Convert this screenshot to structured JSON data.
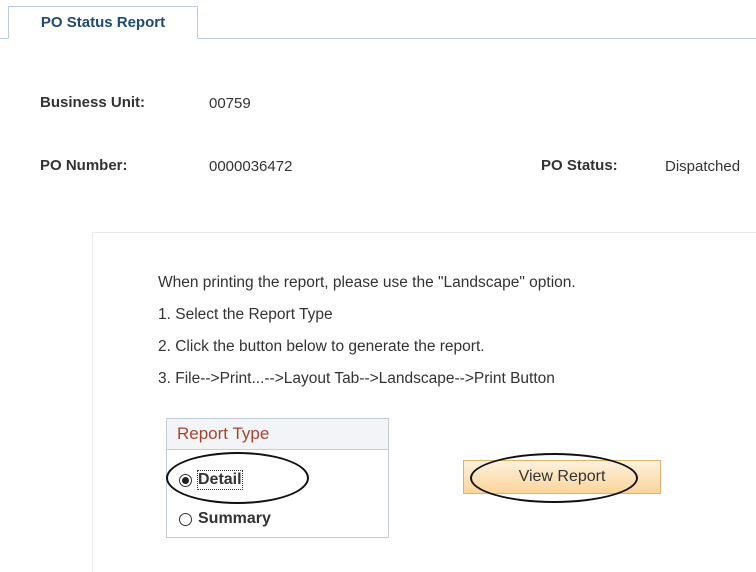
{
  "tab": {
    "label": "PO Status Report"
  },
  "fields": {
    "business_unit": {
      "label": "Business Unit:",
      "value": "00759"
    },
    "po_number": {
      "label": "PO Number:",
      "value": "0000036472"
    },
    "po_status": {
      "label": "PO Status:",
      "value": "Dispatched"
    }
  },
  "instructions": [
    "When printing the report, please use the \"Landscape\" option.",
    "1. Select the Report Type",
    "2. Click the button below to generate the report.",
    "3. File-->Print...-->Layout Tab-->Landscape-->Print Button"
  ],
  "report_type": {
    "title": "Report Type",
    "options": [
      {
        "label": "Detail",
        "selected": true
      },
      {
        "label": "Summary",
        "selected": false
      }
    ]
  },
  "actions": {
    "view_report": "View Report"
  },
  "colors": {
    "tab_text": "#1e4a7a",
    "group_title": "#a8442b",
    "button_top": "#fdf1dc",
    "button_bottom": "#fbd59a"
  }
}
